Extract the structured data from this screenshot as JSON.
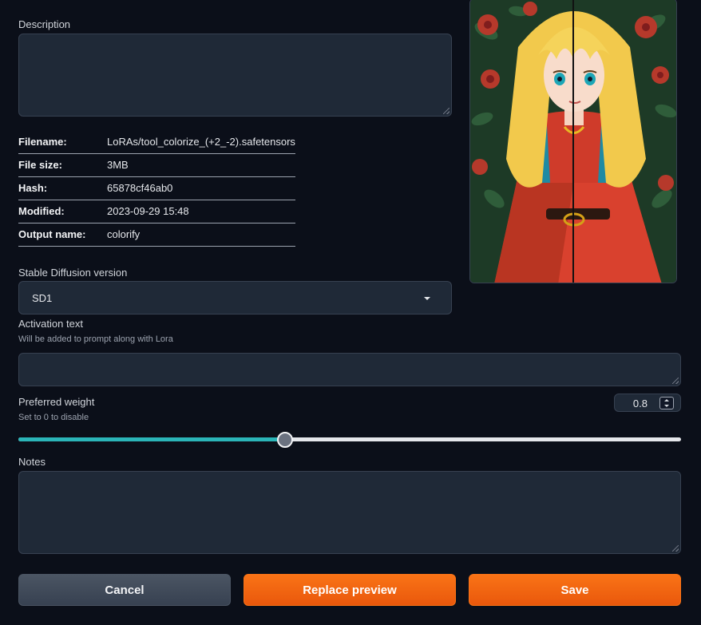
{
  "description": {
    "label": "Description",
    "value": ""
  },
  "info": [
    {
      "key": "Filename:",
      "value": "LoRAs/tool_colorize_(+2_-2).safetensors"
    },
    {
      "key": "File size:",
      "value": "3MB"
    },
    {
      "key": "Hash:",
      "value": "65878cf46ab0"
    },
    {
      "key": "Modified:",
      "value": "2023-09-29 15:48"
    },
    {
      "key": "Output name:",
      "value": "colorify"
    }
  ],
  "sd_version": {
    "label": "Stable Diffusion version",
    "selected": "SD1"
  },
  "activation": {
    "label": "Activation text",
    "hint": "Will be added to prompt along with Lora",
    "value": ""
  },
  "weight": {
    "label": "Preferred weight",
    "hint": "Set to 0 to disable",
    "value": "0.8",
    "fraction": 0.4
  },
  "notes": {
    "label": "Notes",
    "value": ""
  },
  "buttons": {
    "cancel": "Cancel",
    "replace": "Replace preview",
    "save": "Save"
  },
  "colors": {
    "accent": "#f97316",
    "slider": "#14b8a6",
    "background": "#0b0f19"
  }
}
